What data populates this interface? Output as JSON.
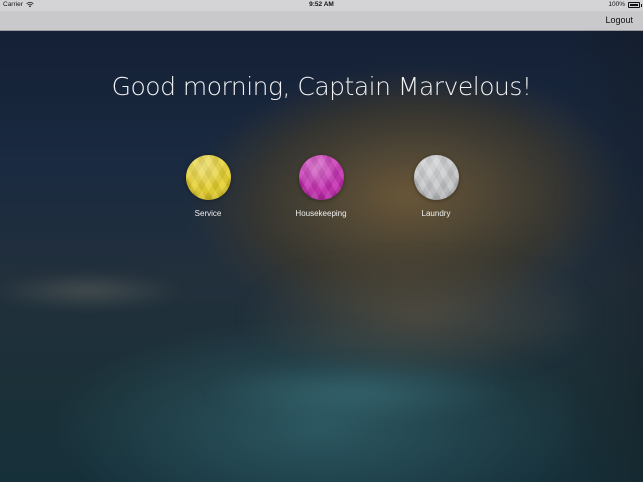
{
  "status_bar": {
    "carrier": "Carrier",
    "time": "9:52 AM",
    "battery": "100%"
  },
  "nav": {
    "logout_label": "Logout"
  },
  "main": {
    "greeting": "Good morning, Captain Marvelous!",
    "services": [
      {
        "label": "Service",
        "icon": "yellow-orb-icon",
        "color": "#e6cf2a"
      },
      {
        "label": "Housekeeping",
        "icon": "magenta-orb-icon",
        "color": "#c42bb0"
      },
      {
        "label": "Laundry",
        "icon": "silver-orb-icon",
        "color": "#c4c5c7"
      }
    ]
  }
}
